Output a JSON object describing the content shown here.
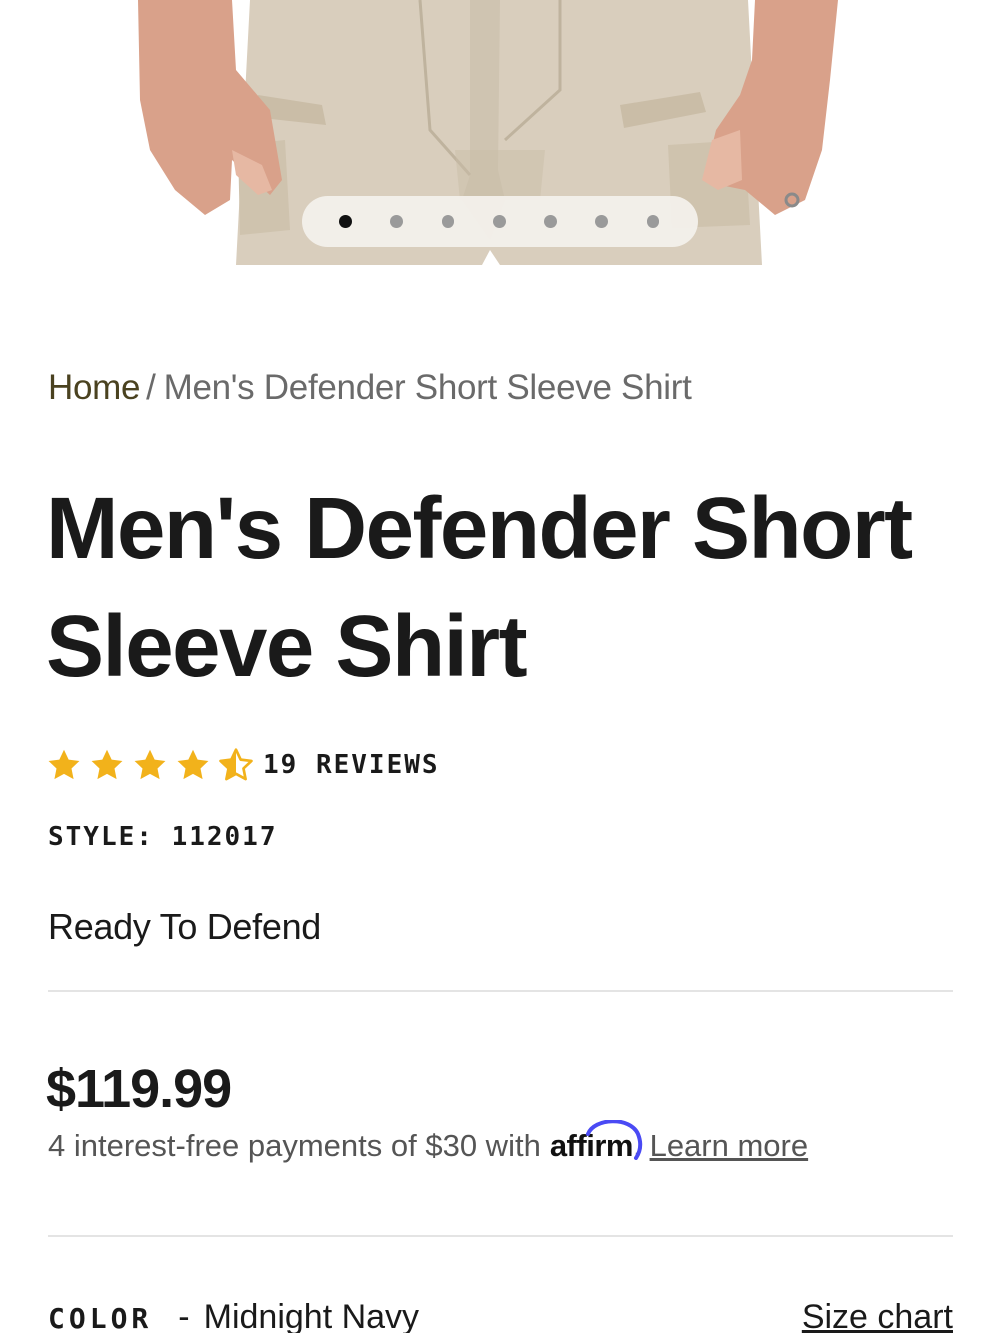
{
  "hero": {
    "image_alt": "khaki pants",
    "carousel": {
      "count": 7,
      "active_index": 0
    }
  },
  "breadcrumb": {
    "home": "Home",
    "separator": "/",
    "current": "Men's Defender Short Sleeve Shirt"
  },
  "product": {
    "title": "Men's Defender Short Sleeve Shirt",
    "rating": {
      "value": 4.5,
      "max": 5,
      "reviews_label": "19 REVIEWS"
    },
    "style_label": "STYLE: 112017",
    "tagline": "Ready To Defend",
    "price": "$119.99",
    "affirm": {
      "prefix": "4 interest-free payments of $30 with",
      "logo": "affirm",
      "period": ".",
      "learn_more": "Learn more"
    },
    "color": {
      "label": "COLOR",
      "separator": "-",
      "value": "Midnight Navy",
      "size_chart": "Size chart"
    }
  },
  "colors": {
    "star": "#f2b21b",
    "breadcrumb_home": "#4a4220",
    "affirm_arc": "#4a4af4",
    "pants": "#d8cdbb",
    "skin": "#d9a28c"
  }
}
